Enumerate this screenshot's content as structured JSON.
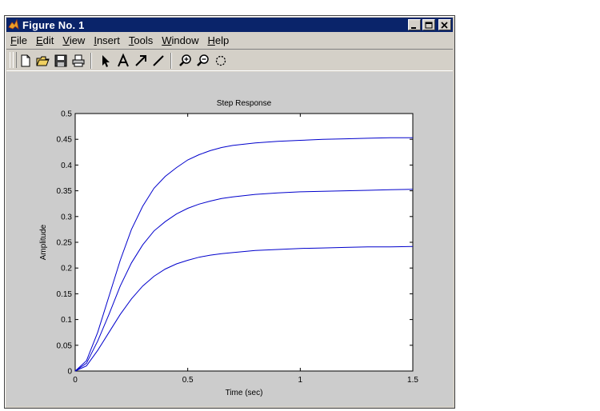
{
  "window": {
    "title": "Figure No. 1",
    "controls": [
      "minimize-icon",
      "maximize-icon",
      "close-icon"
    ]
  },
  "menu": {
    "items": [
      {
        "label": "File",
        "mnemonic": "F",
        "rest": "ile"
      },
      {
        "label": "Edit",
        "mnemonic": "E",
        "rest": "dit"
      },
      {
        "label": "View",
        "mnemonic": "V",
        "rest": "iew"
      },
      {
        "label": "Insert",
        "mnemonic": "I",
        "rest": "nsert"
      },
      {
        "label": "Tools",
        "mnemonic": "T",
        "rest": "ools"
      },
      {
        "label": "Window",
        "mnemonic": "W",
        "rest": "indow"
      },
      {
        "label": "Help",
        "mnemonic": "H",
        "rest": "elp"
      }
    ]
  },
  "toolbar": {
    "buttons": [
      "new-file-icon",
      "open-file-icon",
      "save-icon",
      "print-icon",
      "select-arrow-icon",
      "insert-text-icon",
      "insert-arrow-icon",
      "insert-line-icon",
      "zoom-in-icon",
      "zoom-out-icon",
      "rotate-3d-icon"
    ]
  },
  "chart_data": {
    "type": "line",
    "title": "Step Response",
    "xlabel": "Time (sec)",
    "ylabel": "Amplitude",
    "xlim": [
      0,
      1.5
    ],
    "ylim": [
      0,
      0.5
    ],
    "xticks": [
      "0",
      "0.5",
      "1",
      "1.5"
    ],
    "yticks": [
      "0",
      "0.05",
      "0.1",
      "0.15",
      "0.2",
      "0.25",
      "0.3",
      "0.35",
      "0.4",
      "0.45",
      "0.5"
    ],
    "grid": false,
    "line_color": "#0000cc",
    "series": [
      {
        "x": [
          0,
          0.05,
          0.1,
          0.15,
          0.2,
          0.25,
          0.3,
          0.35,
          0.4,
          0.45,
          0.5,
          0.55,
          0.6,
          0.65,
          0.7,
          0.8,
          0.9,
          1.0,
          1.1,
          1.2,
          1.3,
          1.4,
          1.5
        ],
        "y": [
          0,
          0.02,
          0.075,
          0.145,
          0.215,
          0.275,
          0.32,
          0.355,
          0.378,
          0.395,
          0.41,
          0.42,
          0.428,
          0.434,
          0.438,
          0.443,
          0.446,
          0.448,
          0.45,
          0.451,
          0.452,
          0.453,
          0.453
        ]
      },
      {
        "x": [
          0,
          0.05,
          0.1,
          0.15,
          0.2,
          0.25,
          0.3,
          0.35,
          0.4,
          0.45,
          0.5,
          0.55,
          0.6,
          0.65,
          0.7,
          0.8,
          0.9,
          1.0,
          1.1,
          1.2,
          1.3,
          1.4,
          1.5
        ],
        "y": [
          0,
          0.015,
          0.058,
          0.11,
          0.165,
          0.21,
          0.245,
          0.272,
          0.29,
          0.305,
          0.316,
          0.324,
          0.33,
          0.335,
          0.338,
          0.343,
          0.346,
          0.348,
          0.349,
          0.35,
          0.351,
          0.352,
          0.353
        ]
      },
      {
        "x": [
          0,
          0.05,
          0.1,
          0.15,
          0.2,
          0.25,
          0.3,
          0.35,
          0.4,
          0.45,
          0.5,
          0.55,
          0.6,
          0.65,
          0.7,
          0.8,
          0.9,
          1.0,
          1.1,
          1.2,
          1.3,
          1.4,
          1.5
        ],
        "y": [
          0,
          0.01,
          0.04,
          0.075,
          0.11,
          0.14,
          0.165,
          0.184,
          0.198,
          0.208,
          0.215,
          0.221,
          0.225,
          0.228,
          0.23,
          0.234,
          0.236,
          0.238,
          0.239,
          0.24,
          0.241,
          0.241,
          0.242
        ]
      }
    ]
  }
}
